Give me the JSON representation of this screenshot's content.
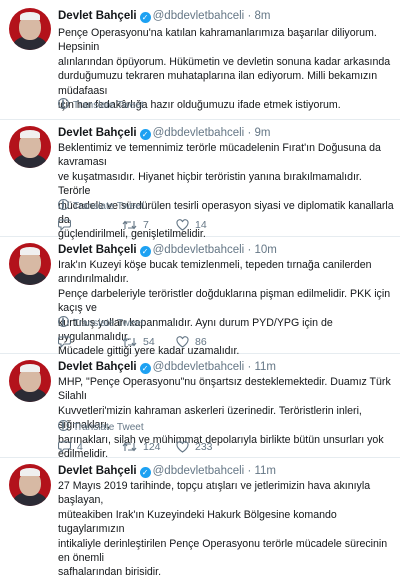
{
  "author": {
    "name": "Devlet Bahçeli",
    "handle": "@dbdevletbahceli",
    "dot": "·"
  },
  "translate_label": "Translate Tweet",
  "tweets": [
    {
      "time": "8m",
      "lines": [
        "Pençe Operasyonu'na katılan kahramanlarımıza başarılar diliyorum. Hepsinin",
        "alınlarından öpüyorum. Hükümetin ve devletin sonuna kadar arkasında",
        "durduğumuzu tekraren muhataplarına ilan ediyorum. Milli bekamızın müdafaası",
        "için her fedakârlığa hazır olduğumuzu ifade etmek istiyorum."
      ],
      "reply": "",
      "retweet": "",
      "like": ""
    },
    {
      "time": "9m",
      "lines": [
        "Beklentimiz ve temennimiz terörle mücadelenin Fırat'ın Doğusuna da kavraması",
        "ve kuşatmasıdır. Hiyanet hiçbir teröristin yanına bırakılmamalıdır. Terörle",
        "mücadele ve sürdürülen tesirli operasyon siyasi ve diplomatik kanallarla da",
        "güçlendirilmeli, genişletilmelidir."
      ],
      "reply": "",
      "retweet": "7",
      "like": "14"
    },
    {
      "time": "10m",
      "lines": [
        "Irak'ın Kuzeyi köşe bucak temizlenmeli, tepeden tırnağa canilerden arındırılmalıdır.",
        "Pençe darbeleriyle teröristler doğduklarına pişman edilmelidir. PKK için kaçış ve",
        "kurtuluş yolları kapanmalıdır. Aynı durum PYD/YPG için de uygulanmalıdır.",
        "Mücadele gittiği yere kadar uzamalıdır."
      ],
      "reply": "",
      "retweet": "54",
      "like": "86"
    },
    {
      "time": "11m",
      "lines": [
        "MHP, \"Pençe Operasyonu\"nu önşartsız desteklemektedir. Duamız Türk Silahlı",
        "Kuvvetleri'mizin kahraman askerleri üzerinedir. Teröristlerin inleri, sığınakları,",
        "barınakları, silah ve mühimmat depolarıyla birlikte bütün unsurları yok edilmelidir."
      ],
      "reply": "4",
      "retweet": "124",
      "like": "233"
    },
    {
      "time": "11m",
      "lines": [
        "27 Mayıs 2019 tarihinde, topçu atışları ve jetlerimizin hava akınıyla başlayan,",
        "müteakiben Irak'ın Kuzeyindeki Hakurk Bölgesine komando tugaylarımızın",
        "intikaliyle derinleştirilen Pençe Operasyonu terörle mücadele sürecinin en önemli",
        "safhalarından birisidir."
      ],
      "reply": "",
      "retweet": "",
      "like": ""
    }
  ]
}
